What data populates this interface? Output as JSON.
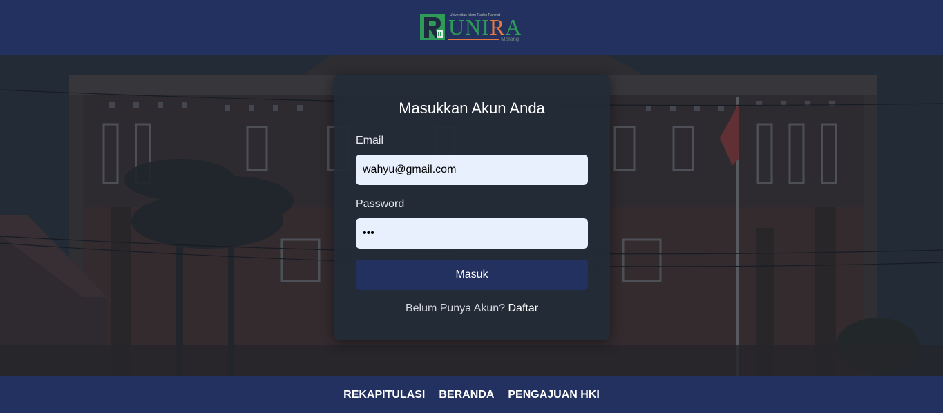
{
  "header": {
    "logo": {
      "tagline": "Universitas Islam Raden Rahmat",
      "word_part1": "UNI",
      "word_part2": "R",
      "word_part3": "A",
      "city": "Malang",
      "brand_green": "#2f9b58",
      "brand_orange": "#e57a3f"
    }
  },
  "login": {
    "title": "Masukkan Akun Anda",
    "email_label": "Email",
    "email_value": "wahyu@gmail.com",
    "password_label": "Password",
    "password_value": "abc",
    "submit_label": "Masuk",
    "register_prompt": "Belum Punya Akun?",
    "register_link": "Daftar"
  },
  "footer": {
    "nav": [
      {
        "label": "REKAPITULASI"
      },
      {
        "label": "BERANDA"
      },
      {
        "label": "PENGAJUAN HKI"
      }
    ]
  },
  "colors": {
    "header_bg": "#233160",
    "card_bg": "#222b38",
    "input_bg": "#e8f0fe",
    "button_bg": "#233160"
  }
}
